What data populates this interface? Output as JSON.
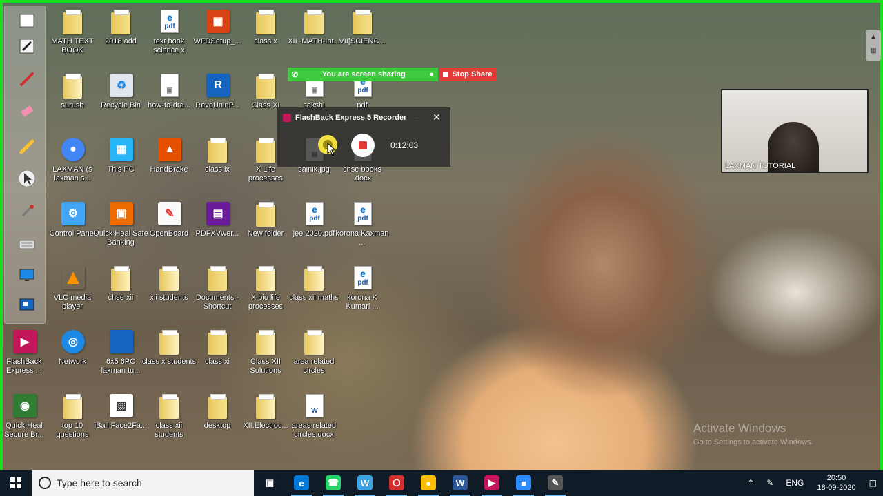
{
  "desktop_icons": [
    {
      "label": "MATH TEXT BOOK",
      "kind": "folder"
    },
    {
      "label": "2018 add",
      "kind": "folder"
    },
    {
      "label": "text book science x",
      "kind": "pdf"
    },
    {
      "label": "WFDSetup_...",
      "kind": "setup"
    },
    {
      "label": "class x",
      "kind": "folder"
    },
    {
      "label": "XII -MATH-Int...",
      "kind": "folder"
    },
    {
      "label": "VII[SCIENC...",
      "kind": "folder"
    },
    {
      "label": "surush",
      "kind": "doc"
    },
    {
      "label": "Recycle Bin",
      "kind": "recycle"
    },
    {
      "label": "how-to-dra...",
      "kind": "image"
    },
    {
      "label": "RevoUninP...",
      "kind": "revo"
    },
    {
      "label": "Class XI",
      "kind": "folder"
    },
    {
      "label": "sakshi",
      "kind": "image"
    },
    {
      "label": "pdf",
      "kind": "pdf"
    },
    {
      "label": "LAXMAN (s laxman s...",
      "kind": "chrome"
    },
    {
      "label": "This PC",
      "kind": "pc"
    },
    {
      "label": "HandBrake",
      "kind": "handbrake"
    },
    {
      "label": "class ix",
      "kind": "folder"
    },
    {
      "label": "X Life processes",
      "kind": "folder"
    },
    {
      "label": "sainik.jpg",
      "kind": "image"
    },
    {
      "label": "chse books .docx",
      "kind": "word"
    },
    {
      "label": "Control Panel",
      "kind": "control"
    },
    {
      "label": "Quick Heal Safe Banking",
      "kind": "quickheal"
    },
    {
      "label": "OpenBoard",
      "kind": "openboard"
    },
    {
      "label": "PDFXVwer...",
      "kind": "pdfx"
    },
    {
      "label": "New folder",
      "kind": "folder"
    },
    {
      "label": "jee 2020.pdf",
      "kind": "pdf"
    },
    {
      "label": "korona Kaxman ...",
      "kind": "pdf"
    },
    {
      "label": "VLC media player",
      "kind": "vlc"
    },
    {
      "label": "chse xii",
      "kind": "doc"
    },
    {
      "label": "xii students",
      "kind": "doc"
    },
    {
      "label": "Documents - Shortcut",
      "kind": "folder"
    },
    {
      "label": "X bio life processes",
      "kind": "doc"
    },
    {
      "label": "class xii maths",
      "kind": "doc"
    },
    {
      "label": "korona K Kumari ...",
      "kind": "pdf"
    },
    {
      "label": "FlashBack Express ...",
      "kind": "flashback"
    },
    {
      "label": "Network",
      "kind": "network"
    },
    {
      "label": "6x5 6PC laxman tu...",
      "kind": "photo"
    },
    {
      "label": "class x students",
      "kind": "doc"
    },
    {
      "label": "class xi",
      "kind": "folder"
    },
    {
      "label": "Class XII Solutions",
      "kind": "doc"
    },
    {
      "label": "area related circles",
      "kind": "doc"
    },
    {
      "label": "Quick Heal Secure Br...",
      "kind": "quickheal2"
    },
    {
      "label": "top 10 questions",
      "kind": "doc"
    },
    {
      "label": "iBall Face2Fa...",
      "kind": "iball"
    },
    {
      "label": "class xii students",
      "kind": "doc"
    },
    {
      "label": "desktop",
      "kind": "folder"
    },
    {
      "label": "XII.Electroc...",
      "kind": "doc"
    },
    {
      "label": "areas related circles.docx",
      "kind": "word"
    }
  ],
  "share_bar": {
    "status": "You are screen sharing",
    "stop_label": "Stop Share"
  },
  "recorder": {
    "title": "FlashBack Express 5 Recorder",
    "timer": "0:12:03",
    "minimize": "–",
    "close": "✕"
  },
  "webcam": {
    "label": "LAXMAN TUTORIAL"
  },
  "watermark": {
    "line1": "Activate Windows",
    "line2": "Go to Settings to activate Windows."
  },
  "taskbar": {
    "search_placeholder": "Type here to search",
    "apps": [
      {
        "name": "task-view",
        "glyph": "▣",
        "color": "#0f1b26"
      },
      {
        "name": "edge",
        "glyph": "e",
        "color": "#0078d7"
      },
      {
        "name": "whatsapp",
        "glyph": "☎",
        "color": "#25d366"
      },
      {
        "name": "webex",
        "glyph": "W",
        "color": "#3aa3e3"
      },
      {
        "name": "pdf-reader",
        "glyph": "⬡",
        "color": "#d32f2f"
      },
      {
        "name": "chrome",
        "glyph": "●",
        "color": "#fbbc05"
      },
      {
        "name": "word",
        "glyph": "W",
        "color": "#2b579a"
      },
      {
        "name": "flashback",
        "glyph": "▶",
        "color": "#c2185b"
      },
      {
        "name": "zoom",
        "glyph": "■",
        "color": "#2d8cff"
      },
      {
        "name": "openboard",
        "glyph": "✎",
        "color": "#555555"
      }
    ],
    "tray_language": "ENG",
    "time": "20:50",
    "date": "18-09-2020"
  }
}
